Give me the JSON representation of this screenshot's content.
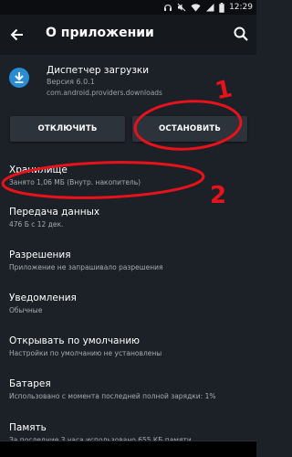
{
  "status_bar": {
    "time": "12:29",
    "icons": [
      "headset-icon",
      "mute-icon",
      "wifi-icon",
      "cellular-signal-icon",
      "battery-icon"
    ]
  },
  "app_bar": {
    "title": "О приложении",
    "back_icon": "arrow-back-icon",
    "search_icon": "search-icon"
  },
  "app": {
    "name": "Диспетчер загрузки",
    "version": "Версия 6.0.1",
    "package": "com.android.providers.downloads",
    "icon": "download-icon",
    "icon_color": "#2a8dd4"
  },
  "buttons": {
    "disable_label": "ОТКЛЮЧИТЬ",
    "stop_label": "ОСТАНОВИТЬ"
  },
  "settings": [
    {
      "title": "Хранилище",
      "subtitle": "Занято 1,06 МБ (Внутр. накопитель)"
    },
    {
      "title": "Передача данных",
      "subtitle": "476 Б с 12 дек."
    },
    {
      "title": "Разрешения",
      "subtitle": "Приложение не запрашивало разрешения"
    },
    {
      "title": "Уведомления",
      "subtitle": "Обычные"
    },
    {
      "title": "Открывать по умолчанию",
      "subtitle": "Настройки по умолчанию не установлены"
    },
    {
      "title": "Батарея",
      "subtitle": "Использовано с момента последней полной зарядки: 1%"
    },
    {
      "title": "Память",
      "subtitle": "За последние 3 часа использовано 655 КБ памяти"
    }
  ],
  "annotations": {
    "label_1": "1",
    "label_2": "2",
    "color": "#e8121c"
  },
  "colors": {
    "background": "#1c2127",
    "app_bar": "#15191e",
    "button": "#2d333a",
    "secondary_text": "#a4abb2"
  }
}
